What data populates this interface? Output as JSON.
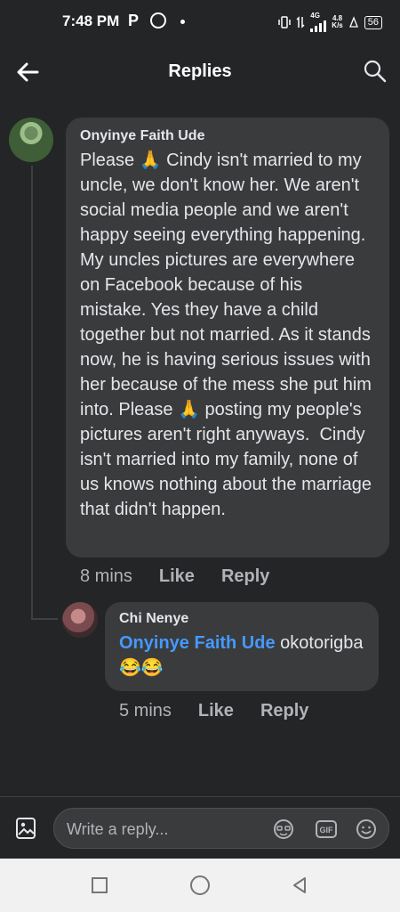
{
  "status_bar": {
    "time": "7:48 PM",
    "app_letter": "P",
    "network": "4G",
    "speed_top": "4.8",
    "speed_bottom": "K/s",
    "battery": "56"
  },
  "header": {
    "title": "Replies",
    "back_icon": "arrow-left-icon",
    "search_icon": "search-icon"
  },
  "comments": [
    {
      "author": "Onyinye Faith Ude",
      "text_parts": [
        "Please ",
        "🙏",
        " Cindy isn't married to my uncle, we don't know her. We aren't social media people and we aren't happy seeing everything happening. My uncles pictures are everywhere on Facebook because of his  mistake. Yes they have a child together but not married. As it stands now, he is having serious issues with her because of the mess she put him into. Please ",
        "🙏",
        " posting my people's pictures aren't right anyways.  Cindy isn't married into my family, none of us knows nothing about the marriage that didn't happen."
      ],
      "time": "8 mins",
      "like": "Like",
      "reply": "Reply"
    },
    {
      "author": "Chi Nenye",
      "mention": "Onyinye Faith Ude",
      "text": " okotorigba",
      "emojis": "😂😂",
      "time": "5 mins",
      "like": "Like",
      "reply": "Reply"
    }
  ],
  "composer": {
    "placeholder": "Write a reply...",
    "gif_label": "GIF"
  },
  "colors": {
    "background": "#242526",
    "bubble": "#3a3b3c",
    "mention": "#4599ff",
    "secondary_text": "#b0b3b8"
  }
}
